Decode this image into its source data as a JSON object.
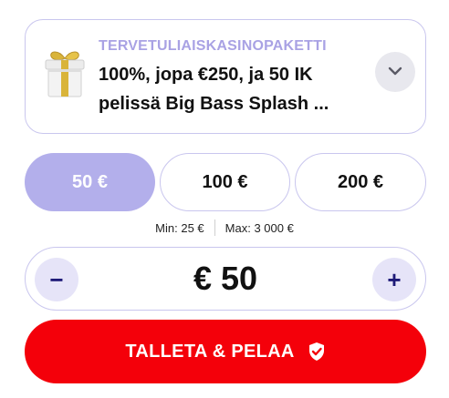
{
  "bonus": {
    "eyebrow": "TERVETULIAISKASINOPAKETTI",
    "title": "100%, jopa €250, ja 50 IK pelissä Big Bass Splash ...",
    "icon": "gift-icon",
    "expand_icon": "chevron-down-icon"
  },
  "amounts": [
    {
      "label": "50 €",
      "selected": true
    },
    {
      "label": "100 €",
      "selected": false
    },
    {
      "label": "200 €",
      "selected": false
    }
  ],
  "limits": {
    "min": "Min: 25 €",
    "max": "Max: 3 000 €"
  },
  "stepper": {
    "value": "€ 50",
    "decrement_label": "−",
    "increment_label": "+"
  },
  "cta": {
    "label": "TALLETA & PELAA",
    "icon": "shield-check-icon"
  },
  "colors": {
    "accent": "#b3afeb",
    "border": "#c9c6ee",
    "cta": "#f4000a",
    "stepper_button": "#e6e4f8",
    "stepper_text": "#1e1a78",
    "eyebrow": "#a9a2e4"
  }
}
